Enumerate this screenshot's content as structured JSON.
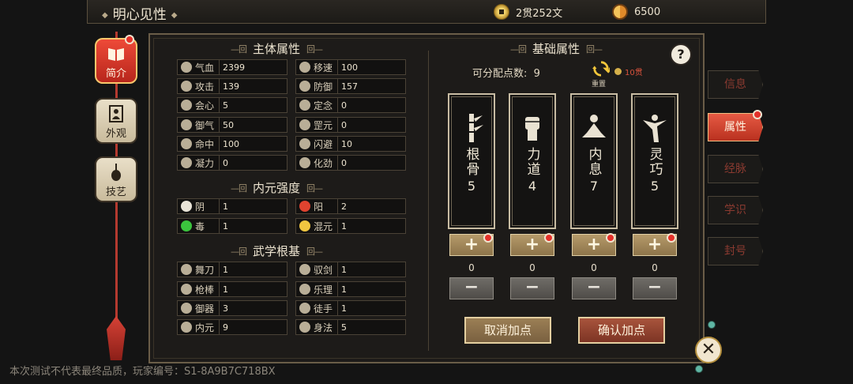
{
  "header": {
    "title": "明心见性",
    "money": "2贯252文",
    "yinyang_points": "6500"
  },
  "left_nav": [
    {
      "label": "简介",
      "active": true,
      "icon": "book-icon"
    },
    {
      "label": "外观",
      "active": false,
      "icon": "portrait-icon"
    },
    {
      "label": "技艺",
      "active": false,
      "icon": "pipa-icon"
    }
  ],
  "main_attrs": {
    "title": "主体属性",
    "items": [
      {
        "name": "气血",
        "value": "2399",
        "icon": "leaf-icon"
      },
      {
        "name": "移速",
        "value": "100",
        "icon": "boot-icon"
      },
      {
        "name": "攻击",
        "value": "139",
        "icon": "crossed-swords-icon"
      },
      {
        "name": "防御",
        "value": "157",
        "icon": "shield-icon"
      },
      {
        "name": "会心",
        "value": "5",
        "icon": "lotus-icon"
      },
      {
        "name": "定念",
        "value": "0",
        "icon": "meditate-icon"
      },
      {
        "name": "御气",
        "value": "50",
        "icon": "swirl-icon"
      },
      {
        "name": "罡元",
        "value": "0",
        "icon": "orb-icon"
      },
      {
        "name": "命中",
        "value": "100",
        "icon": "target-icon"
      },
      {
        "name": "闪避",
        "value": "10",
        "icon": "dodge-icon"
      },
      {
        "name": "凝力",
        "value": "0",
        "icon": "fist-icon"
      },
      {
        "name": "化劲",
        "value": "0",
        "icon": "palm-icon"
      }
    ]
  },
  "inner_strength": {
    "title": "内元强度",
    "items": [
      {
        "name": "阴",
        "value": "1",
        "icon": "moon-icon"
      },
      {
        "name": "阳",
        "value": "2",
        "icon": "sun-icon"
      },
      {
        "name": "毒",
        "value": "1",
        "icon": "skull-icon"
      },
      {
        "name": "混元",
        "value": "1",
        "icon": "taiji-icon"
      }
    ]
  },
  "martial_roots": {
    "title": "武学根基",
    "items": [
      {
        "name": "舞刀",
        "value": "1",
        "icon": "blade-icon"
      },
      {
        "name": "驭剑",
        "value": "1",
        "icon": "sword-icon"
      },
      {
        "name": "枪棒",
        "value": "1",
        "icon": "spear-icon"
      },
      {
        "name": "乐理",
        "value": "1",
        "icon": "music-icon"
      },
      {
        "name": "御器",
        "value": "3",
        "icon": "feather-icon"
      },
      {
        "name": "徒手",
        "value": "1",
        "icon": "hand-icon"
      },
      {
        "name": "内元",
        "value": "9",
        "icon": "meditate-icon"
      },
      {
        "name": "身法",
        "value": "5",
        "icon": "run-icon"
      }
    ]
  },
  "base_attrs": {
    "title": "基础属性",
    "free_points_label": "可分配点数:",
    "free_points": "9",
    "reset_label": "重置",
    "reset_cost": "10贯",
    "cards": [
      {
        "name": "根骨",
        "value": "5",
        "added": "0",
        "icon": "bamboo-icon"
      },
      {
        "name": "力道",
        "value": "4",
        "added": "0",
        "icon": "fist-icon"
      },
      {
        "name": "内息",
        "value": "7",
        "added": "0",
        "icon": "meditate-icon"
      },
      {
        "name": "灵巧",
        "value": "5",
        "added": "0",
        "icon": "dancer-icon"
      }
    ],
    "plus_label": "+",
    "minus_label": "−",
    "cancel_label": "取消加点",
    "confirm_label": "确认加点"
  },
  "right_tabs": [
    {
      "label": "信息",
      "active": false
    },
    {
      "label": "属性",
      "active": true
    },
    {
      "label": "经脉",
      "active": false
    },
    {
      "label": "学识",
      "active": false
    },
    {
      "label": "封号",
      "active": false
    }
  ],
  "help_label": "?",
  "close_label": "✕",
  "footer": "本次测试不代表最终品质，玩家编号：S1-8A9B7C718BX"
}
